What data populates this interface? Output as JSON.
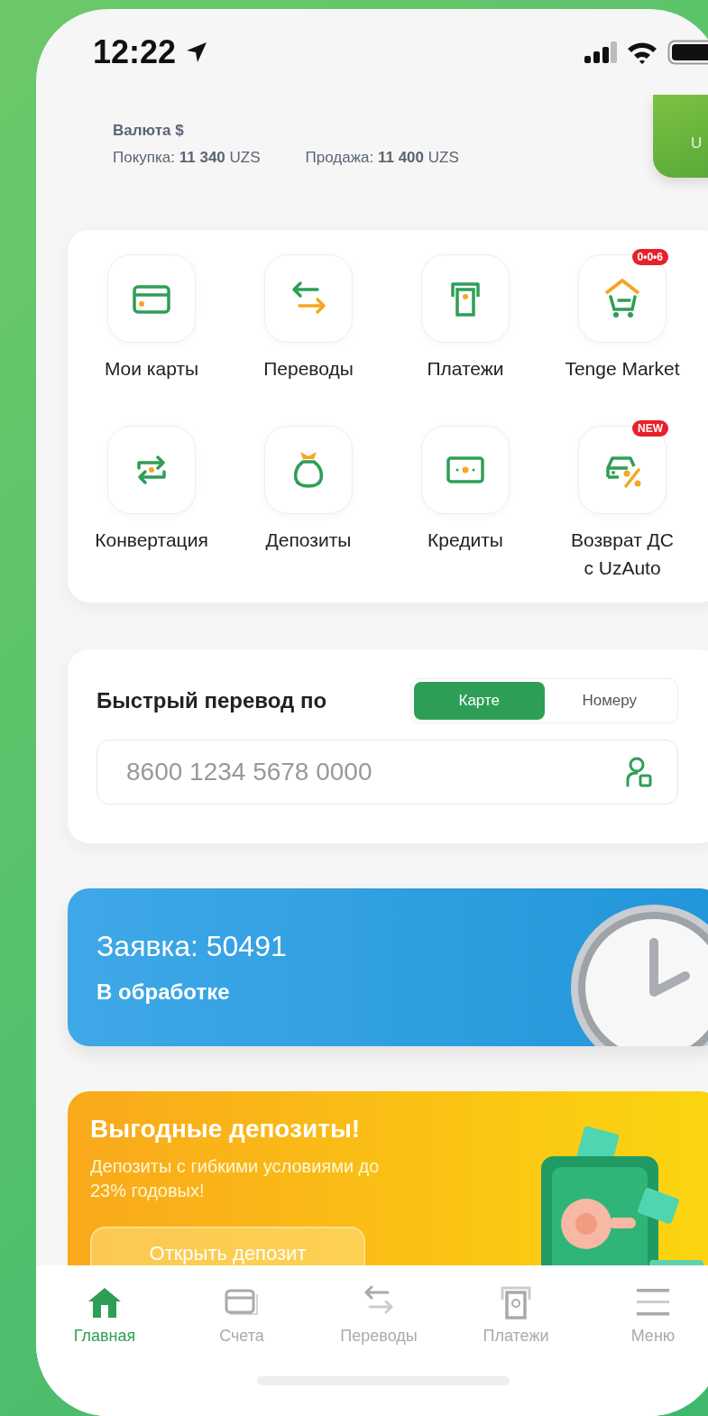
{
  "status_bar": {
    "time": "12:22"
  },
  "currency": {
    "title": "Валюта $",
    "buy": "Покупка: **11 340** UZS",
    "sell": "Продажа: **11 400** UZS"
  },
  "card_peek": {
    "text": "U"
  },
  "services": [
    {
      "label": "Мои карты"
    },
    {
      "label": "Переводы"
    },
    {
      "label": "Платежи"
    },
    {
      "label": "Tenge Market",
      "badge": "0•0•6"
    },
    {
      "label": "Конвертация"
    },
    {
      "label": "Депозиты"
    },
    {
      "label": "Кредиты"
    },
    {
      "label": "Возврат ДС с UzAuto",
      "badge": "NEW"
    }
  ],
  "quick_transfer": {
    "title": "Быстрый перевод по",
    "tabs": [
      {
        "label": "Карте",
        "selected": true
      },
      {
        "label": "Номеру",
        "selected": false
      }
    ],
    "input": {
      "placeholder": "8600 1234 5678 0000"
    }
  },
  "request_banner": {
    "title": "Заявка: 50491",
    "status": "В обработке"
  },
  "promo_banner": {
    "title": "Выгодные депозиты!",
    "text": "Депозиты с гибкими условиями до 23% годовых!",
    "button": "Открыть депозит"
  },
  "nav": [
    {
      "label": "Главная",
      "selected": true
    },
    {
      "label": "Счета",
      "selected": false
    },
    {
      "label": "Переводы",
      "selected": false
    },
    {
      "label": "Платежи",
      "selected": false
    },
    {
      "label": "Меню",
      "selected": false
    }
  ]
}
